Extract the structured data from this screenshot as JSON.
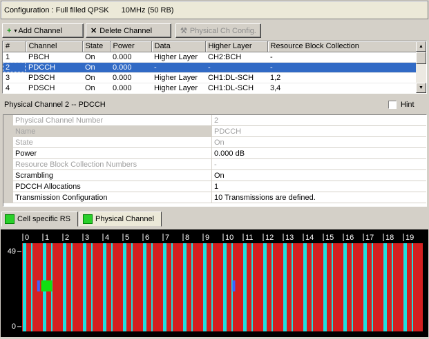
{
  "config": {
    "label": "Configuration : Full filled QPSK",
    "bandwidth": "10MHz (50 RB)"
  },
  "toolbar": {
    "add": "Add Channel",
    "delete": "Delete Channel",
    "phys": "Physical Ch Config."
  },
  "table": {
    "headers": [
      "#",
      "Channel",
      "State",
      "Power",
      "Data",
      "Higher Layer",
      "Resource Block Collection"
    ],
    "rows": [
      [
        "1",
        "PBCH",
        "On",
        "0.000",
        "Higher Layer",
        "CH2:BCH",
        "-"
      ],
      [
        "2",
        "PDCCH",
        "On",
        "0.000",
        "-",
        "-",
        "-"
      ],
      [
        "3",
        "PDSCH",
        "On",
        "0.000",
        "Higher Layer",
        "CH1:DL-SCH",
        "1,2"
      ],
      [
        "4",
        "PDSCH",
        "On",
        "0.000",
        "Higher Layer",
        "CH1:DL-SCH",
        "3,4"
      ]
    ]
  },
  "detail": {
    "title": "Physical Channel 2 -- PDCCH",
    "hint": "Hint"
  },
  "props": [
    {
      "k": "Physical Channel Number",
      "v": "2"
    },
    {
      "k": "Name",
      "v": "PDCCH"
    },
    {
      "k": "State",
      "v": "On"
    },
    {
      "k": "Power",
      "v": "0.000 dB"
    },
    {
      "k": "Resource Block Collection Numbers",
      "v": "-"
    },
    {
      "k": "Scrambling",
      "v": "On"
    },
    {
      "k": "PDCCH Allocations",
      "v": "1"
    },
    {
      "k": "Transmission Configuration",
      "v": "10 Transmissions are defined."
    }
  ],
  "tabs": {
    "cell_rs": "Cell specific RS",
    "phys_ch": "Physical Channel"
  },
  "grid": {
    "y_top": "49",
    "y_bottom": "0",
    "x_labels": [
      "0",
      "1",
      "2",
      "3",
      "4",
      "5",
      "6",
      "7",
      "8",
      "9",
      "10",
      "11",
      "12",
      "13",
      "14",
      "15",
      "16",
      "17",
      "18",
      "19"
    ],
    "colors": {
      "red": "#d42020",
      "cyan": "#1ee0e0",
      "green": "#10e010",
      "blue": "#4060ff"
    }
  }
}
